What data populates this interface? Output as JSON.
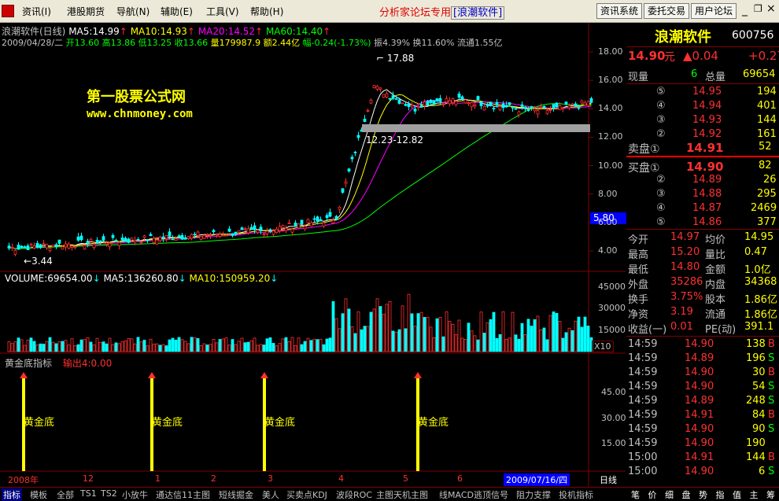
{
  "menu": {
    "items": [
      "资讯(I)",
      "港股期货",
      "导航(N)",
      "辅助(E)",
      "工具(V)",
      "帮助(H)"
    ],
    "forum_text": "分析家论坛专用",
    "forum_brand": "[浪潮软件]",
    "buttons": [
      "资讯系统",
      "委托交易",
      "用户论坛"
    ]
  },
  "chart_header": {
    "line1": {
      "stock": "浪潮软件(日线)",
      "ma5": "MA5:14.99",
      "ma10": "MA10:14.93",
      "ma20": "MA20:14.52",
      "ma60": "MA60:14.40"
    },
    "line2": {
      "date": "2009/04/28/二",
      "open": "开13.60",
      "high": "高13.86",
      "low": "低13.25",
      "close": "收13.66",
      "volume": "量179987.9",
      "amount": "额2.44亿",
      "change": "幅-0.24(-1.73%)",
      "amplitude": "振4.39%",
      "turnover": "换11.60%",
      "float": "流通1.55亿"
    }
  },
  "watermark": {
    "title": "第一股票公式网",
    "url": "www.chnmoney.com"
  },
  "annotations": {
    "peak": "17.88",
    "range": "12.23-12.82",
    "low": "3.44",
    "price_marker": "5.80"
  },
  "price_axis": [
    "18.00",
    "16.00",
    "14.00",
    "12.00",
    "10.00",
    "8.00",
    "6.00",
    "4.00"
  ],
  "volume_header": {
    "vol": "VOLUME:69654.00",
    "ma5": "MA5:136260.80",
    "ma10": "MA10:150959.20"
  },
  "volume_axis": [
    "45000",
    "30000",
    "15000"
  ],
  "volume_unit": "X10",
  "indicator": {
    "name": "黄金底指标",
    "output": "输出4:0.00",
    "signal_label": "黄金底",
    "axis": [
      "45.00",
      "30.00",
      "15.00"
    ]
  },
  "time_axis": {
    "labels": [
      "2008年",
      "12",
      "1",
      "2",
      "3",
      "4",
      "5",
      "6"
    ],
    "current_date": "2009/07/16/四",
    "period": "日线"
  },
  "quote": {
    "name": "浪潮软件",
    "code": "600756",
    "price": "14.90",
    "unit": "元",
    "change": "▲0.04",
    "change2": "+0.27",
    "now_label": "现量",
    "now_val": "6",
    "total_label": "总量",
    "total_val": "69654",
    "asks": [
      {
        "level": "⑤",
        "price": "14.95",
        "vol": "194"
      },
      {
        "level": "④",
        "price": "14.94",
        "vol": "401"
      },
      {
        "level": "③",
        "price": "14.93",
        "vol": "144"
      },
      {
        "level": "②",
        "price": "14.92",
        "vol": "161"
      }
    ],
    "ask1_label": "卖盘①",
    "ask1_price": "14.91",
    "ask1_vol": "52",
    "bid1_label": "买盘①",
    "bid1_price": "14.90",
    "bid1_vol": "82",
    "bids": [
      {
        "level": "②",
        "price": "14.89",
        "vol": "26"
      },
      {
        "level": "③",
        "price": "14.88",
        "vol": "295"
      },
      {
        "level": "④",
        "price": "14.87",
        "vol": "2469"
      },
      {
        "level": "⑤",
        "price": "14.86",
        "vol": "377"
      }
    ],
    "stats": [
      {
        "l1": "今开",
        "v1": "14.97",
        "l2": "均价",
        "v2": "14.95"
      },
      {
        "l1": "最高",
        "v1": "15.20",
        "l2": "量比",
        "v2": "0.47"
      },
      {
        "l1": "最低",
        "v1": "14.80",
        "l2": "金额",
        "v2": "1.0亿"
      },
      {
        "l1": "外盘",
        "v1": "35286",
        "l2": "内盘",
        "v2": "34368"
      },
      {
        "l1": "换手",
        "v1": "3.75%",
        "l2": "股本",
        "v2": "1.86亿"
      },
      {
        "l1": "净资",
        "v1": "3.19",
        "l2": "流通",
        "v2": "1.86亿"
      },
      {
        "l1": "收益(一)",
        "v1": "0.01",
        "l2": "PE(动)",
        "v2": "391.1"
      }
    ],
    "ticks": [
      {
        "t": "14:59",
        "p": "14.90",
        "v": "138",
        "d": "B"
      },
      {
        "t": "14:59",
        "p": "14.89",
        "v": "196",
        "d": "S"
      },
      {
        "t": "14:59",
        "p": "14.90",
        "v": "30",
        "d": "B"
      },
      {
        "t": "14:59",
        "p": "14.90",
        "v": "54",
        "d": "S"
      },
      {
        "t": "14:59",
        "p": "14.89",
        "v": "248",
        "d": "S"
      },
      {
        "t": "14:59",
        "p": "14.91",
        "v": "84",
        "d": "B"
      },
      {
        "t": "14:59",
        "p": "14.90",
        "v": "90",
        "d": "S"
      },
      {
        "t": "14:59",
        "p": "14.90",
        "v": "190",
        "d": ""
      },
      {
        "t": "15:00",
        "p": "14.91",
        "v": "144",
        "d": "B"
      },
      {
        "t": "15:00",
        "p": "14.90",
        "v": "6",
        "d": "S"
      }
    ]
  },
  "bottom_tabs": [
    "指标",
    "模板",
    "全部",
    "TS1",
    "TS2",
    "小放牛",
    "通达信11主图",
    "短线掘金",
    "美人",
    "买卖点KDJ",
    "波段ROC",
    "主图天机主图",
    "线MACD",
    "逃顶信号",
    "阻力支撑",
    "投机指标"
  ],
  "right_tabs": [
    "笔",
    "价",
    "细",
    "盘",
    "势",
    "指",
    "值",
    "主",
    "筹"
  ],
  "colors": {
    "up": "#ff3030",
    "down": "#00ffff",
    "ma5": "#ffffff",
    "ma10": "#ffff00",
    "ma20": "#ff00ff",
    "ma60": "#00ff00"
  }
}
